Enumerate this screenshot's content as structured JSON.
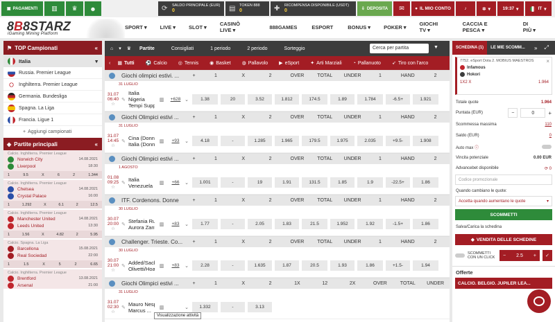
{
  "topbar": {
    "payments": "PAGAMENTI",
    "balance_label": "SALDO PRINCIPALE (EUR)",
    "balance_value": "0",
    "token_label": "TOKEN 888",
    "token_value": "0",
    "reward_label": "RICOMPENSA DISPONIBILE (USDT)",
    "reward_value": "0",
    "deposit": "DEPOSITA",
    "account": "IL MIO CONTO",
    "clock": "19:37",
    "lang": "IT"
  },
  "logo": {
    "prefix": "8",
    "mid": "B",
    "rest": "8STARZ",
    "sub": "iGaming Mining Platform"
  },
  "nav": [
    "SPORT",
    "LIVE",
    "SLOT",
    "CASINÒ LIVE",
    "888GAMES",
    "ESPORT",
    "BONUS",
    "POKER",
    "GIOCHI TV",
    "CACCIA E PESCA",
    "DI PIÙ"
  ],
  "left": {
    "top_title": "TOP Campionati",
    "selected": "Italia",
    "leagues": [
      "Russia. Premier League",
      "Inghilterra. Premier League",
      "Germania. Bundesliga",
      "Spagna. La Liga",
      "Francia. Ligue 1"
    ],
    "add": "Aggiungi campionati",
    "main_title": "Partite principali",
    "matches": [
      {
        "league": "Calcio. Inghilterra. Premier League",
        "t1": "Norwich City",
        "t2": "Liverpool",
        "d1": "14.08.2021",
        "d2": "18:30",
        "odds": [
          "1",
          "9.5",
          "X",
          "6",
          "2",
          "1.344"
        ]
      },
      {
        "league": "Calcio. Inghilterra. Premier League",
        "t1": "Chelsea",
        "t2": "Crystal Palace",
        "d1": "14.08.2021",
        "d2": "16:00",
        "odds": [
          "1",
          "1.292",
          "X",
          "6.1",
          "2",
          "12.5"
        ]
      },
      {
        "league": "Calcio. Inghilterra. Premier League",
        "t1": "Manchester United",
        "t2": "Leeds United",
        "d1": "14.08.2021",
        "d2": "13:30",
        "odds": [
          "1",
          "1.56",
          "X",
          "4.82",
          "2",
          "5.95"
        ]
      },
      {
        "league": "Calcio. Spagna. La Liga",
        "t1": "Barcellona",
        "t2": "Real Sociedad",
        "d1": "15.08.2021",
        "d2": "22:00",
        "odds": [
          "1",
          "1.5",
          "X",
          "5",
          "2",
          "6.65"
        ]
      },
      {
        "league": "Calcio. Inghilterra. Premier League",
        "t1": "Brentford",
        "t2": "Arsenal",
        "d1": "13.08.2021",
        "d2": "21:00",
        "odds": []
      }
    ]
  },
  "center": {
    "tabs": [
      "Partite",
      "Consigliati",
      "1 periodo",
      "2 periodo",
      "Sorteggio"
    ],
    "search": "Cerca per partita",
    "sports": [
      "Tutti",
      "Calcio",
      "Tennis",
      "Basket",
      "Pallavolo",
      "eSport",
      "Arti Marziali",
      "Pallanuoto",
      "Tiro con l'arco"
    ],
    "groups": [
      {
        "name": "Giochi olimpici estivi. ...",
        "cols": [
          "1",
          "X",
          "2",
          "OVER",
          "TOTAL",
          "UNDER",
          "1",
          "HAND",
          "2"
        ],
        "date": "31 LUGLIO",
        "match": {
          "time": "31.07\n06:40",
          "teams": [
            "Italia",
            "Nigeria",
            "Tempi Supple..."
          ],
          "count": "+628",
          "odds": [
            "1.38",
            "20",
            "3.52",
            "1.812",
            "174.5",
            "1.89",
            "1.784",
            "-6.5+",
            "1.921"
          ]
        }
      },
      {
        "name": "Giochi Olimpici estivi ...",
        "cols": [
          "1",
          "X",
          "2",
          "OVER",
          "TOTAL",
          "UNDER",
          "1",
          "HAND",
          "2"
        ],
        "date": "31 LUGLIO",
        "match": {
          "time": "31.07\n14:45",
          "teams": [
            "Cina (Donne)",
            "Italia (Donne)"
          ],
          "count": "+93",
          "odds": [
            "4.18",
            "-",
            "1.285",
            "1.965",
            "179.5",
            "1.975",
            "2.035",
            "+9.5-",
            "1.908"
          ]
        }
      },
      {
        "name": "Giochi Olimpici estivi ...",
        "cols": [
          "1",
          "X",
          "2",
          "OVER",
          "TOTAL",
          "UNDER",
          "1",
          "HAND",
          "2"
        ],
        "date": "1 AGOSTO",
        "match": {
          "time": "01.08\n09:25",
          "teams": [
            "Italia",
            "Venezuela"
          ],
          "count": "+66",
          "odds": [
            "1.001",
            "-",
            "19",
            "1.91",
            "131.5",
            "1.85",
            "1.9",
            "-22.5+",
            "1.86"
          ]
        }
      },
      {
        "name": "ITF. Cordenons. Donne",
        "cols": [
          "1",
          "X",
          "2",
          "OVER",
          "TOTAL",
          "UNDER",
          "1",
          "HAND",
          "2"
        ],
        "date": "30 LUGLIO",
        "match": {
          "time": "30.07\n20:00",
          "teams": [
            "Stefania Rubini",
            "Aurora Zanted..."
          ],
          "count": "+83",
          "odds": [
            "1.77",
            "-",
            "2.05",
            "1.83",
            "21.5",
            "1.952",
            "1.92",
            "-1.5+",
            "1.86"
          ]
        }
      },
      {
        "name": "Challenger. Trieste. Co...",
        "cols": [
          "1",
          "X",
          "2",
          "OVER",
          "TOTAL",
          "UNDER",
          "1",
          "HAND",
          "2"
        ],
        "date": "30 LUGLIO",
        "match": {
          "time": "30.07\n21:00",
          "teams": [
            "Added/Sachko",
            "Olivetti/Hoang"
          ],
          "count": "+83",
          "odds": [
            "2.28",
            "-",
            "1.635",
            "1.87",
            "20.5",
            "1.93",
            "1.86",
            "+1.5-",
            "1.94"
          ]
        }
      },
      {
        "name": "Giochi Olimpici estivi ...",
        "cols": [
          "1",
          "X",
          "2",
          "1X",
          "12",
          "2X",
          "OVER",
          "TOTAL",
          "UNDER"
        ],
        "date": "31 LUGLIO",
        "match": {
          "time": "31.07\n02:30",
          "teams": [
            "Mauro Nespoli",
            "Marcus ..."
          ],
          "count": "",
          "odds": [
            "1.332",
            "-",
            "3.13",
            "",
            "",
            "",
            "",
            "",
            ""
          ]
        }
      }
    ],
    "tooltip": "Visualizzazione attività"
  },
  "right": {
    "tab1": "SCHEDINA (1)",
    "tab2": "LE MIE SCOMM...",
    "bet_event": "7752. eSport Dota 2. MOBIUS MAESTROS",
    "bet_team1": "Infamous",
    "bet_team2": "Hokori",
    "bet_type": "1X2 X",
    "bet_odd": "1.964",
    "total_label": "Totale quote",
    "total_value": "1.964",
    "stake_label": "Puntata (EUR)",
    "stake_value": "0",
    "max_label": "Scommessa massima",
    "max_value": "110",
    "balance_label": "Saldo (EUR)",
    "balance_value": "0",
    "automax": "Auto max",
    "potential_label": "Vincita potenziale",
    "potential_value": "0.00 EUR",
    "advance_label": "Advancebet disponibile",
    "advance_value": "0",
    "promo_placeholder": "Codice promozionale",
    "change_label": "Quando cambiano le quote:",
    "change_value": "Accetta quando aumentano le quote",
    "bet_btn": "SCOMMETTI",
    "save_link": "Salva/Carica la schedina",
    "sell_btn": "VENDITA DELLE SCHEDINE",
    "oneclick": "SCOMMETTI CON UN CLICK",
    "oneclick_value": "2.5",
    "offers": "Offerte",
    "banner": "CALCIO. BELGIO. JUPILER LEA..."
  }
}
